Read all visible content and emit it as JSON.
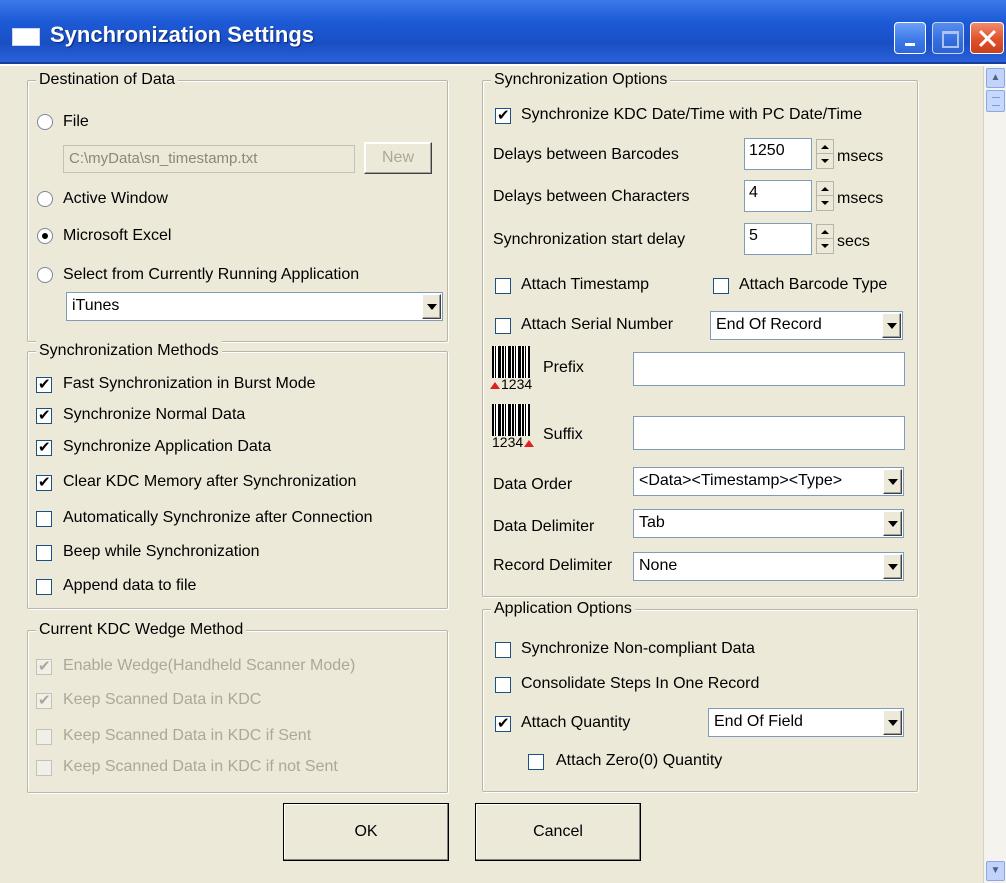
{
  "window": {
    "title": "Synchronization Settings"
  },
  "destination": {
    "legend": "Destination of Data",
    "file_label": "File",
    "file_path": "C:\\myData\\sn_timestamp.txt",
    "new_label": "New",
    "active_window_label": "Active Window",
    "excel_label": "Microsoft Excel",
    "running_app_label": "Select from Currently Running Application",
    "running_app_value": "iTunes",
    "selected": "Microsoft Excel"
  },
  "methods": {
    "legend": "Synchronization Methods",
    "items": [
      {
        "label": "Fast Synchronization in Burst Mode",
        "checked": true
      },
      {
        "label": "Synchronize Normal Data",
        "checked": true
      },
      {
        "label": "Synchronize Application Data",
        "checked": true
      },
      {
        "label": "Clear KDC Memory after Synchronization",
        "checked": true
      },
      {
        "label": "Automatically Synchronize after Connection",
        "checked": false
      },
      {
        "label": "Beep while Synchronization",
        "checked": false
      },
      {
        "label": "Append data to file",
        "checked": false
      }
    ]
  },
  "wedge": {
    "legend": "Current KDC Wedge Method",
    "items": [
      {
        "label": "Enable Wedge(Handheld Scanner Mode)",
        "checked": true
      },
      {
        "label": "Keep Scanned Data in KDC",
        "checked": true
      },
      {
        "label": "Keep Scanned Data in KDC if Sent",
        "checked": false
      },
      {
        "label": "Keep Scanned Data in KDC if not Sent",
        "checked": false
      }
    ]
  },
  "sync_options": {
    "legend": "Synchronization Options",
    "sync_datetime_label": "Synchronize KDC Date/Time with PC Date/Time",
    "sync_datetime_checked": true,
    "delay_barcodes_label": "Delays between Barcodes",
    "delay_barcodes_value": "1250",
    "delay_barcodes_unit": "msecs",
    "delay_chars_label": "Delays between Characters",
    "delay_chars_value": "4",
    "delay_chars_unit": "msecs",
    "start_delay_label": "Synchronization start delay",
    "start_delay_value": "5",
    "start_delay_unit": "secs",
    "attach_timestamp_label": "Attach Timestamp",
    "attach_barcode_type_label": "Attach Barcode Type",
    "attach_serial_label": "Attach Serial Number",
    "serial_position": "End Of Record",
    "barcode_sample": "1234",
    "prefix_label": "Prefix",
    "prefix_value": "",
    "suffix_label": "Suffix",
    "suffix_value": "",
    "data_order_label": "Data Order",
    "data_order_value": "<Data><Timestamp><Type>",
    "data_delimiter_label": "Data Delimiter",
    "data_delimiter_value": "Tab",
    "record_delimiter_label": "Record Delimiter",
    "record_delimiter_value": "None"
  },
  "app_options": {
    "legend": "Application Options",
    "non_compliant_label": "Synchronize Non-compliant Data",
    "non_compliant_checked": false,
    "consolidate_label": "Consolidate Steps In One Record",
    "consolidate_checked": false,
    "attach_quantity_label": "Attach Quantity",
    "attach_quantity_checked": true,
    "quantity_position": "End Of Field",
    "attach_zero_label": "Attach Zero(0) Quantity",
    "attach_zero_checked": false
  },
  "buttons": {
    "ok": "OK",
    "cancel": "Cancel"
  }
}
